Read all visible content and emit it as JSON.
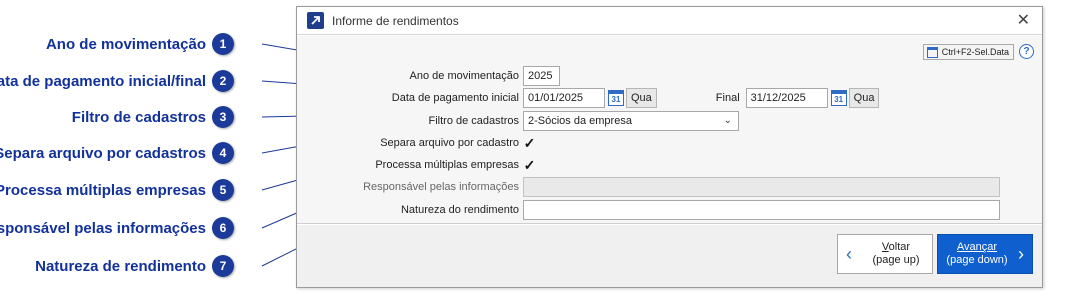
{
  "callouts": [
    {
      "num": "1",
      "label": "Ano de movimentação"
    },
    {
      "num": "2",
      "label": "Data de pagamento inicial/final"
    },
    {
      "num": "3",
      "label": "Filtro de cadastros"
    },
    {
      "num": "4",
      "label": "Separa arquivo por cadastros"
    },
    {
      "num": "5",
      "label": "Processa múltiplas empresas"
    },
    {
      "num": "6",
      "label": "Responsável pelas informações"
    },
    {
      "num": "7",
      "label": "Natureza de rendimento"
    }
  ],
  "dialog": {
    "title": "Informe de rendimentos",
    "shortcut_button": "Ctrl+F2-Sel.Data",
    "help": "?"
  },
  "form": {
    "ano_label": "Ano de movimentação",
    "ano_value": "2025",
    "data_inicial_label": "Data de pagamento inicial",
    "data_inicial_value": "01/01/2025",
    "data_inicial_weekday": "Qua",
    "data_final_label": "Final",
    "data_final_value": "31/12/2025",
    "data_final_weekday": "Qua",
    "calendar_glyph": "31",
    "filtro_label": "Filtro de cadastros",
    "filtro_value": "2-Sócios da empresa",
    "separa_label": "Separa arquivo por cadastro",
    "separa_checked": true,
    "processa_label": "Processa múltiplas empresas",
    "processa_checked": true,
    "responsavel_label": "Responsável pelas informações",
    "responsavel_value": "",
    "natureza_label": "Natureza do rendimento",
    "natureza_value": ""
  },
  "footer": {
    "back_key": "V",
    "back_rest": "oltar",
    "back_sub": "(page up)",
    "next_key": "A",
    "next_rest": "vançar",
    "next_sub": "(page down)"
  },
  "colors": {
    "callout_text": "#12329a",
    "callout_badge": "#1c3a9a",
    "primary_button": "#0f5fcf"
  }
}
